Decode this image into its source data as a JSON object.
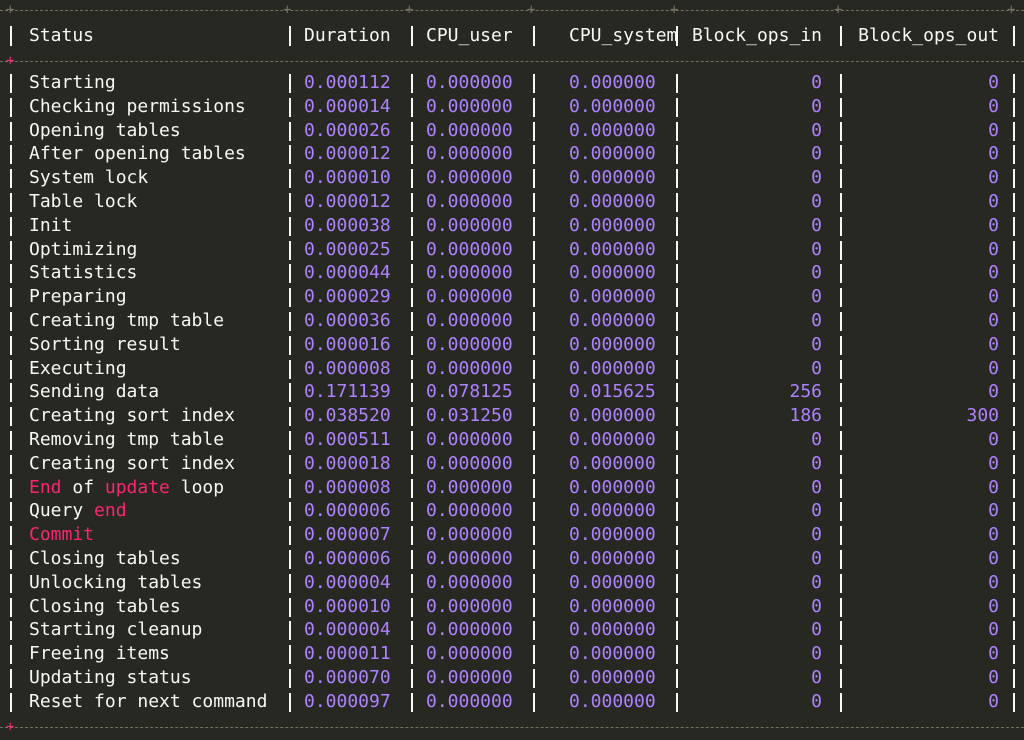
{
  "columns": [
    "Status",
    "Duration",
    "CPU_user",
    "CPU_system",
    "Block_ops_in",
    "Block_ops_out"
  ],
  "rows": [
    {
      "status": [
        {
          "t": "Starting",
          "k": false
        }
      ],
      "duration": "0.000112",
      "cpu_user": "0.000000",
      "cpu_system": "0.000000",
      "block_in": "0",
      "block_out": "0"
    },
    {
      "status": [
        {
          "t": "Checking permissions",
          "k": false
        }
      ],
      "duration": "0.000014",
      "cpu_user": "0.000000",
      "cpu_system": "0.000000",
      "block_in": "0",
      "block_out": "0"
    },
    {
      "status": [
        {
          "t": "Opening tables",
          "k": false
        }
      ],
      "duration": "0.000026",
      "cpu_user": "0.000000",
      "cpu_system": "0.000000",
      "block_in": "0",
      "block_out": "0"
    },
    {
      "status": [
        {
          "t": "After opening tables",
          "k": false
        }
      ],
      "duration": "0.000012",
      "cpu_user": "0.000000",
      "cpu_system": "0.000000",
      "block_in": "0",
      "block_out": "0"
    },
    {
      "status": [
        {
          "t": "System lock",
          "k": false
        }
      ],
      "duration": "0.000010",
      "cpu_user": "0.000000",
      "cpu_system": "0.000000",
      "block_in": "0",
      "block_out": "0"
    },
    {
      "status": [
        {
          "t": "Table lock",
          "k": false
        }
      ],
      "duration": "0.000012",
      "cpu_user": "0.000000",
      "cpu_system": "0.000000",
      "block_in": "0",
      "block_out": "0"
    },
    {
      "status": [
        {
          "t": "Init",
          "k": false
        }
      ],
      "duration": "0.000038",
      "cpu_user": "0.000000",
      "cpu_system": "0.000000",
      "block_in": "0",
      "block_out": "0"
    },
    {
      "status": [
        {
          "t": "Optimizing",
          "k": false
        }
      ],
      "duration": "0.000025",
      "cpu_user": "0.000000",
      "cpu_system": "0.000000",
      "block_in": "0",
      "block_out": "0"
    },
    {
      "status": [
        {
          "t": "Statistics",
          "k": false
        }
      ],
      "duration": "0.000044",
      "cpu_user": "0.000000",
      "cpu_system": "0.000000",
      "block_in": "0",
      "block_out": "0"
    },
    {
      "status": [
        {
          "t": "Preparing",
          "k": false
        }
      ],
      "duration": "0.000029",
      "cpu_user": "0.000000",
      "cpu_system": "0.000000",
      "block_in": "0",
      "block_out": "0"
    },
    {
      "status": [
        {
          "t": "Creating tmp table",
          "k": false
        }
      ],
      "duration": "0.000036",
      "cpu_user": "0.000000",
      "cpu_system": "0.000000",
      "block_in": "0",
      "block_out": "0"
    },
    {
      "status": [
        {
          "t": "Sorting result",
          "k": false
        }
      ],
      "duration": "0.000016",
      "cpu_user": "0.000000",
      "cpu_system": "0.000000",
      "block_in": "0",
      "block_out": "0"
    },
    {
      "status": [
        {
          "t": "Executing",
          "k": false
        }
      ],
      "duration": "0.000008",
      "cpu_user": "0.000000",
      "cpu_system": "0.000000",
      "block_in": "0",
      "block_out": "0"
    },
    {
      "status": [
        {
          "t": "Sending data",
          "k": false
        }
      ],
      "duration": "0.171139",
      "cpu_user": "0.078125",
      "cpu_system": "0.015625",
      "block_in": "256",
      "block_out": "0"
    },
    {
      "status": [
        {
          "t": "Creating sort index",
          "k": false
        }
      ],
      "duration": "0.038520",
      "cpu_user": "0.031250",
      "cpu_system": "0.000000",
      "block_in": "186",
      "block_out": "300"
    },
    {
      "status": [
        {
          "t": "Removing tmp table",
          "k": false
        }
      ],
      "duration": "0.000511",
      "cpu_user": "0.000000",
      "cpu_system": "0.000000",
      "block_in": "0",
      "block_out": "0"
    },
    {
      "status": [
        {
          "t": "Creating sort index",
          "k": false
        }
      ],
      "duration": "0.000018",
      "cpu_user": "0.000000",
      "cpu_system": "0.000000",
      "block_in": "0",
      "block_out": "0"
    },
    {
      "status": [
        {
          "t": "End",
          "k": true
        },
        {
          "t": " of ",
          "k": false
        },
        {
          "t": "update",
          "k": true
        },
        {
          "t": " loop",
          "k": false
        }
      ],
      "duration": "0.000008",
      "cpu_user": "0.000000",
      "cpu_system": "0.000000",
      "block_in": "0",
      "block_out": "0"
    },
    {
      "status": [
        {
          "t": "Query ",
          "k": false
        },
        {
          "t": "end",
          "k": true
        }
      ],
      "duration": "0.000006",
      "cpu_user": "0.000000",
      "cpu_system": "0.000000",
      "block_in": "0",
      "block_out": "0"
    },
    {
      "status": [
        {
          "t": "Commit",
          "k": true
        }
      ],
      "duration": "0.000007",
      "cpu_user": "0.000000",
      "cpu_system": "0.000000",
      "block_in": "0",
      "block_out": "0"
    },
    {
      "status": [
        {
          "t": "Closing tables",
          "k": false
        }
      ],
      "duration": "0.000006",
      "cpu_user": "0.000000",
      "cpu_system": "0.000000",
      "block_in": "0",
      "block_out": "0"
    },
    {
      "status": [
        {
          "t": "Unlocking tables",
          "k": false
        }
      ],
      "duration": "0.000004",
      "cpu_user": "0.000000",
      "cpu_system": "0.000000",
      "block_in": "0",
      "block_out": "0"
    },
    {
      "status": [
        {
          "t": "Closing tables",
          "k": false
        }
      ],
      "duration": "0.000010",
      "cpu_user": "0.000000",
      "cpu_system": "0.000000",
      "block_in": "0",
      "block_out": "0"
    },
    {
      "status": [
        {
          "t": "Starting cleanup",
          "k": false
        }
      ],
      "duration": "0.000004",
      "cpu_user": "0.000000",
      "cpu_system": "0.000000",
      "block_in": "0",
      "block_out": "0"
    },
    {
      "status": [
        {
          "t": "Freeing items",
          "k": false
        }
      ],
      "duration": "0.000011",
      "cpu_user": "0.000000",
      "cpu_system": "0.000000",
      "block_in": "0",
      "block_out": "0"
    },
    {
      "status": [
        {
          "t": "Updating status",
          "k": false
        }
      ],
      "duration": "0.000070",
      "cpu_user": "0.000000",
      "cpu_system": "0.000000",
      "block_in": "0",
      "block_out": "0"
    },
    {
      "status": [
        {
          "t": "Reset for next command",
          "k": false
        }
      ],
      "duration": "0.000097",
      "cpu_user": "0.000000",
      "cpu_system": "0.000000",
      "block_in": "0",
      "block_out": "0"
    }
  ],
  "colors": {
    "background": "#272822",
    "text": "#f8f8f2",
    "number": "#ae81ff",
    "keyword": "#f92672",
    "border": "#75715e"
  }
}
